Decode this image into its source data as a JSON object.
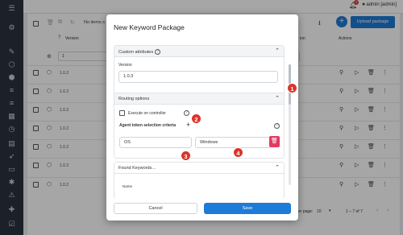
{
  "topbar": {
    "user": "admin [admin]",
    "badge_count": "1"
  },
  "page": {
    "items_label": "No items s",
    "col_version": "Version",
    "col_version_right": "ion",
    "col_actions": "Actions",
    "filter_value": "1",
    "upload_label": "Upload package",
    "rows": [
      "1.0.2",
      "1.0.2",
      "1.0.2",
      "1.0.2",
      "1.0.2",
      "1.0.2",
      "1.0.2"
    ],
    "per_page_label": "er page:",
    "per_page_value": "10",
    "pagination": "1 – 7 of 7"
  },
  "modal": {
    "title": "New Keyword Package",
    "custom_attributes": {
      "title": "Custom attributes",
      "version_label": "Version",
      "version_value": "1.0.3"
    },
    "routing": {
      "title": "Routing options",
      "execute_label": "Execute on controller",
      "criteria_label": "Agent token selection criteria",
      "criteria_key": "OS",
      "criteria_value": "Windows"
    },
    "found_keywords": {
      "title": "Found Keywords...",
      "name_col": "Name"
    },
    "cancel_label": "Cancel",
    "save_label": "Save"
  },
  "callouts": [
    "1",
    "2",
    "3",
    "4"
  ],
  "colors": {
    "primary": "#1e7bd6",
    "danger": "#e33a62",
    "callout": "#d9342b",
    "sidebar": "#2b3340"
  }
}
